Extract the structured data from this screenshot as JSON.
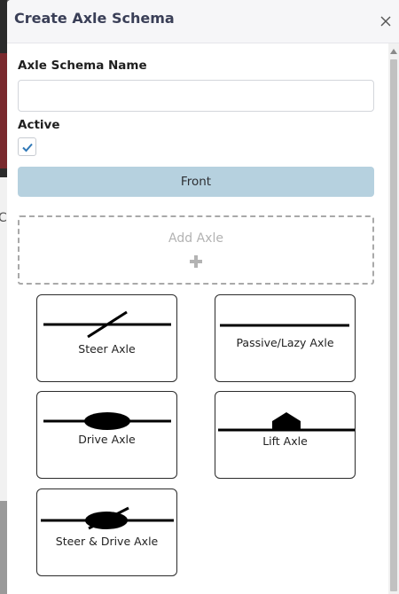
{
  "modal": {
    "title": "Create Axle Schema",
    "close_icon": "close-icon"
  },
  "form": {
    "name_label": "Axle Schema Name",
    "name_value": "",
    "name_placeholder": "",
    "active_label": "Active",
    "active_checked": true
  },
  "section": {
    "label": "Front",
    "color": "#b6d1df"
  },
  "add_axle": {
    "label": "Add Axle",
    "icon": "plus-icon"
  },
  "axle_types": [
    {
      "label": "Steer Axle",
      "icon": "steer-axle-icon"
    },
    {
      "label": "Passive/Lazy Axle",
      "icon": "passive-axle-icon"
    },
    {
      "label": "Drive Axle",
      "icon": "drive-axle-icon"
    },
    {
      "label": "Lift Axle",
      "icon": "lift-axle-icon"
    },
    {
      "label": "Steer & Drive Axle",
      "icon": "steer-drive-axle-icon"
    }
  ],
  "background_glyph": "C"
}
